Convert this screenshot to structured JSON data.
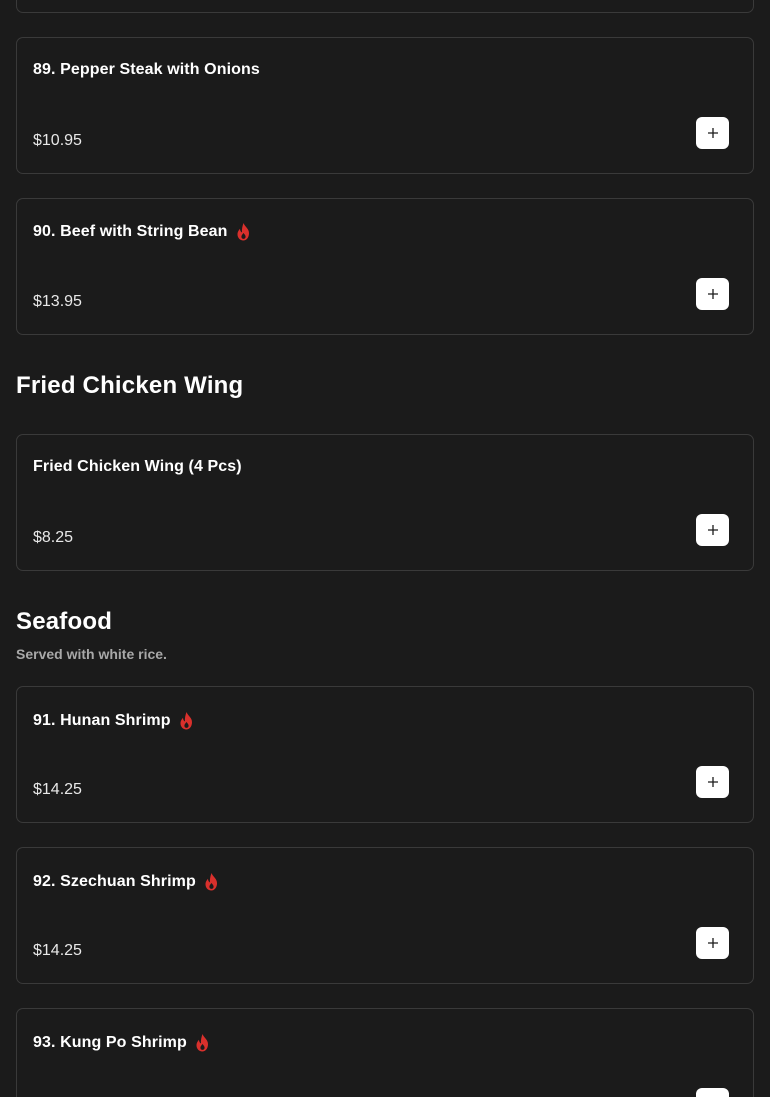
{
  "menu": {
    "items": [
      {
        "name": "89. Pepper Steak with Onions",
        "price": "$10.95",
        "spicy": false
      },
      {
        "name": "90. Beef with String Bean",
        "price": "$13.95",
        "spicy": true
      },
      {
        "name": "Fried Chicken Wing (4 Pcs)",
        "price": "$8.25",
        "spicy": false
      },
      {
        "name": "91. Hunan Shrimp",
        "price": "$14.25",
        "spicy": true
      },
      {
        "name": "92. Szechuan Shrimp",
        "price": "$14.25",
        "spicy": true
      },
      {
        "name": "93. Kung Po Shrimp",
        "price": "",
        "spicy": true
      }
    ],
    "sections": [
      {
        "title": "Fried Chicken Wing",
        "description": ""
      },
      {
        "title": "Seafood",
        "description": "Served with white rice."
      }
    ]
  },
  "colors": {
    "background": "#1b1b1b",
    "card_border": "#3a3a3a",
    "spicy": "#d9302c",
    "button": "#ffffff"
  },
  "icons": {
    "add": "plus-icon",
    "spicy": "flame-icon"
  }
}
